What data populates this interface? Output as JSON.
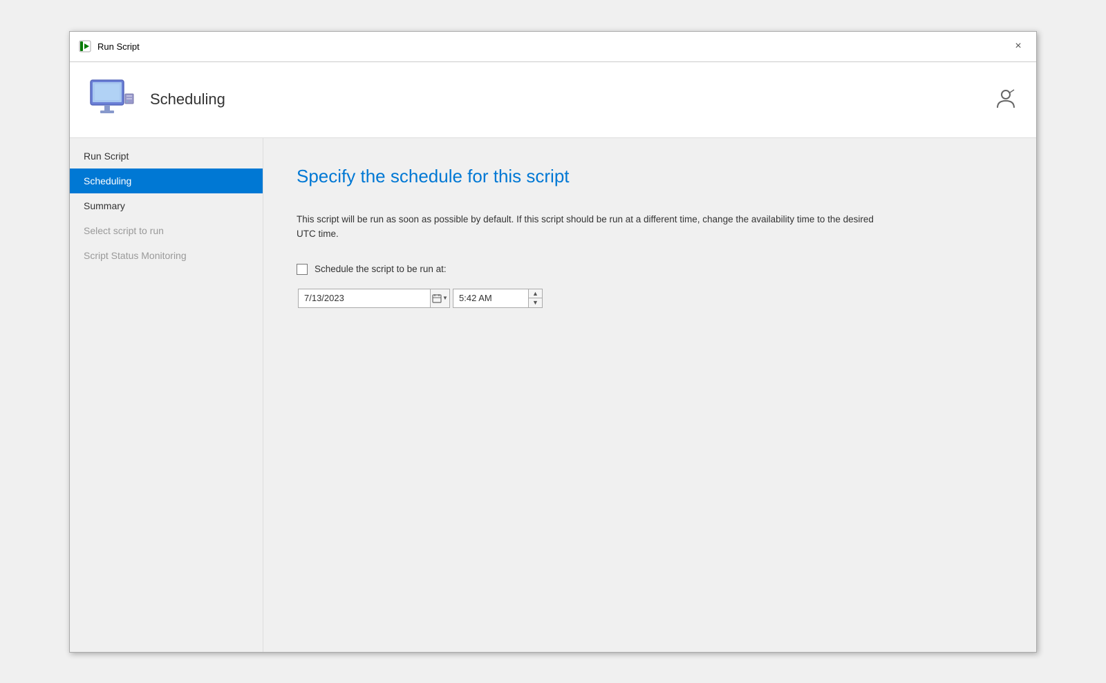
{
  "titleBar": {
    "title": "Run Script",
    "closeLabel": "×"
  },
  "header": {
    "title": "Scheduling"
  },
  "sidebar": {
    "items": [
      {
        "id": "run-script",
        "label": "Run Script",
        "state": "normal"
      },
      {
        "id": "scheduling",
        "label": "Scheduling",
        "state": "active"
      },
      {
        "id": "summary",
        "label": "Summary",
        "state": "normal"
      },
      {
        "id": "select-script",
        "label": "Select script to run",
        "state": "disabled"
      },
      {
        "id": "script-status",
        "label": "Script Status Monitoring",
        "state": "disabled"
      }
    ]
  },
  "content": {
    "heading": "Specify the schedule for this script",
    "description": "This script will be run as soon as possible by default. If this script should be run at a different time, change the availability time to the desired UTC time.",
    "scheduleCheckboxLabel": "Schedule the script to be run at:",
    "dateValue": "7/13/2023",
    "timeValue": "5:42 AM"
  }
}
